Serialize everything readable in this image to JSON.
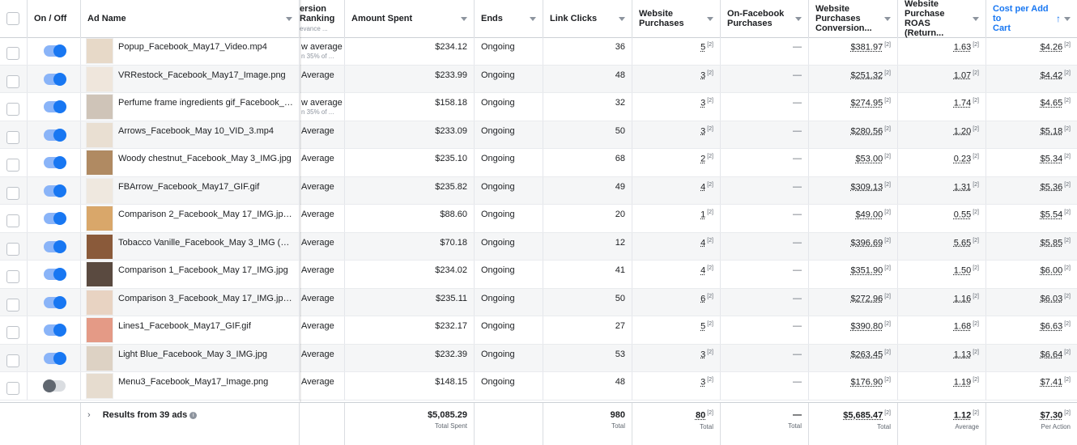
{
  "columns": {
    "on_off": "On / Off",
    "ad_name": "Ad Name",
    "conversion_ranking": [
      "ersion",
      "Ranking",
      "evance ..."
    ],
    "amount_spent": "Amount Spent",
    "ends": "Ends",
    "link_clicks": "Link Clicks",
    "website_purchases": [
      "Website",
      "Purchases"
    ],
    "on_facebook_purchases": [
      "On-Facebook",
      "Purchases"
    ],
    "website_purchases_conversion": [
      "Website",
      "Purchases",
      "Conversion..."
    ],
    "website_purchase_roas": [
      "Website",
      "Purchase",
      "ROAS (Return..."
    ],
    "cost_per_add_to_cart": [
      "Cost per Add to",
      "Cart"
    ]
  },
  "rows": [
    {
      "on": true,
      "name": "Popup_Facebook_May17_Video.mp4",
      "ranking": "w average",
      "ranking_sub": "n 35% of ...",
      "spent": "$234.12",
      "ends": "Ongoing",
      "clicks": "36",
      "purchases": "5",
      "fb_purchases": "—",
      "conversion": "$381.97",
      "roas": "1.63",
      "cpatc": "$4.26",
      "thumb": "#e7d9c8"
    },
    {
      "on": true,
      "name": "VRRestock_Facebook_May17_Image.png",
      "ranking": "Average",
      "ranking_sub": "",
      "spent": "$233.99",
      "ends": "Ongoing",
      "clicks": "48",
      "purchases": "3",
      "fb_purchases": "—",
      "conversion": "$251.32",
      "roas": "1.07",
      "cpatc": "$4.42",
      "thumb": "#efe6dc"
    },
    {
      "on": true,
      "name": "Perfume frame ingredients gif_Facebook_M...",
      "ranking": "w average",
      "ranking_sub": "n 35% of ...",
      "spent": "$158.18",
      "ends": "Ongoing",
      "clicks": "32",
      "purchases": "3",
      "fb_purchases": "—",
      "conversion": "$274.95",
      "roas": "1.74",
      "cpatc": "$4.65",
      "thumb": "#cfc4b8"
    },
    {
      "on": true,
      "name": "Arrows_Facebook_May 10_VID_3.mp4",
      "ranking": "Average",
      "ranking_sub": "",
      "spent": "$233.09",
      "ends": "Ongoing",
      "clicks": "50",
      "purchases": "3",
      "fb_purchases": "—",
      "conversion": "$280.56",
      "roas": "1.20",
      "cpatc": "$5.18",
      "thumb": "#e9dfd2"
    },
    {
      "on": true,
      "name": "Woody chestnut_Facebook_May 3_IMG.jpg",
      "ranking": "Average",
      "ranking_sub": "",
      "spent": "$235.10",
      "ends": "Ongoing",
      "clicks": "68",
      "purchases": "2",
      "fb_purchases": "—",
      "conversion": "$53.00",
      "roas": "0.23",
      "cpatc": "$5.34",
      "thumb": "#b08a62"
    },
    {
      "on": true,
      "name": "FBArrow_Facebook_May17_GIF.gif",
      "ranking": "Average",
      "ranking_sub": "",
      "spent": "$235.82",
      "ends": "Ongoing",
      "clicks": "49",
      "purchases": "4",
      "fb_purchases": "—",
      "conversion": "$309.13",
      "roas": "1.31",
      "cpatc": "$5.36",
      "thumb": "#efe8df"
    },
    {
      "on": true,
      "name": "Comparison 2_Facebook_May 17_IMG.jpg.j...",
      "ranking": "Average",
      "ranking_sub": "",
      "spent": "$88.60",
      "ends": "Ongoing",
      "clicks": "20",
      "purchases": "1",
      "fb_purchases": "—",
      "conversion": "$49.00",
      "roas": "0.55",
      "cpatc": "$5.54",
      "thumb": "#d9a76a"
    },
    {
      "on": true,
      "name": "Tobacco Vanille_Facebook_May 3_IMG (1).j...",
      "ranking": "Average",
      "ranking_sub": "",
      "spent": "$70.18",
      "ends": "Ongoing",
      "clicks": "12",
      "purchases": "4",
      "fb_purchases": "—",
      "conversion": "$396.69",
      "roas": "5.65",
      "cpatc": "$5.85",
      "thumb": "#8a5a3a"
    },
    {
      "on": true,
      "name": "Comparison 1_Facebook_May 17_IMG.jpg",
      "ranking": "Average",
      "ranking_sub": "",
      "spent": "$234.02",
      "ends": "Ongoing",
      "clicks": "41",
      "purchases": "4",
      "fb_purchases": "—",
      "conversion": "$351.90",
      "roas": "1.50",
      "cpatc": "$6.00",
      "thumb": "#5a4a40"
    },
    {
      "on": true,
      "name": "Comparison 3_Facebook_May 17_IMG.jpg.j...",
      "ranking": "Average",
      "ranking_sub": "",
      "spent": "$235.11",
      "ends": "Ongoing",
      "clicks": "50",
      "purchases": "6",
      "fb_purchases": "—",
      "conversion": "$272.96",
      "roas": "1.16",
      "cpatc": "$6.03",
      "thumb": "#e8d3c2"
    },
    {
      "on": true,
      "name": "Lines1_Facebook_May17_GIF.gif",
      "ranking": "Average",
      "ranking_sub": "",
      "spent": "$232.17",
      "ends": "Ongoing",
      "clicks": "27",
      "purchases": "5",
      "fb_purchases": "—",
      "conversion": "$390.80",
      "roas": "1.68",
      "cpatc": "$6.63",
      "thumb": "#e49a86"
    },
    {
      "on": true,
      "name": "Light Blue_Facebook_May 3_IMG.jpg",
      "ranking": "Average",
      "ranking_sub": "",
      "spent": "$232.39",
      "ends": "Ongoing",
      "clicks": "53",
      "purchases": "3",
      "fb_purchases": "—",
      "conversion": "$263.45",
      "roas": "1.13",
      "cpatc": "$6.64",
      "thumb": "#ddd2c4"
    },
    {
      "on": false,
      "name": "Menu3_Facebook_May17_Image.png",
      "ranking": "Average",
      "ranking_sub": "",
      "spent": "$148.15",
      "ends": "Ongoing",
      "clicks": "48",
      "purchases": "3",
      "fb_purchases": "—",
      "conversion": "$176.90",
      "roas": "1.19",
      "cpatc": "$7.41",
      "thumb": "#e6dccf"
    }
  ],
  "sup_note": "[2]",
  "footer": {
    "results_label": "Results from 39 ads",
    "spent": "$5,085.29",
    "spent_label": "Total Spent",
    "clicks": "980",
    "clicks_label": "Total",
    "purchases": "80",
    "purchases_label": "Total",
    "fb_purchases": "—",
    "fb_purchases_label": "Total",
    "conversion": "$5,685.47",
    "conversion_label": "Total",
    "roas": "1.12",
    "roas_label": "Average",
    "cpatc": "$7.30",
    "cpatc_label": "Per Action"
  },
  "colors": {
    "accent": "#1877f2",
    "toggle_on": "#1877f2",
    "toggle_off": "#606770"
  }
}
